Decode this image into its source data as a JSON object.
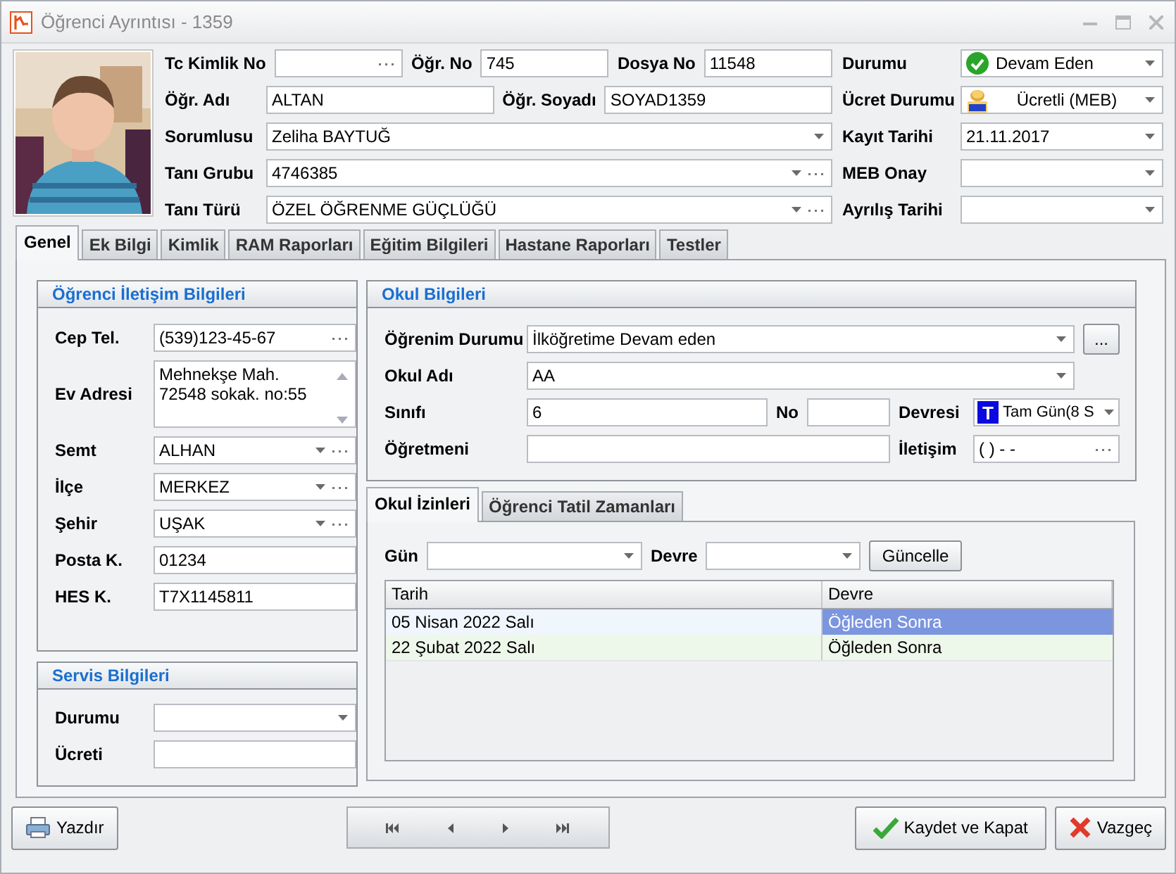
{
  "window": {
    "title": "Öğrenci Ayrıntısı - 1359"
  },
  "header": {
    "left_rows": [
      [
        {
          "label": "Tc Kimlik No",
          "kind": "ellipsis"
        },
        {
          "label": "Öğr. No",
          "value": "745",
          "kind": "text"
        },
        {
          "label": "Dosya No",
          "value": "11548",
          "kind": "text"
        }
      ],
      [
        {
          "label": "Öğr. Adı",
          "value": "ALTAN",
          "kind": "text"
        },
        {
          "label": "Öğr. Soyadı",
          "value": "SOYAD1359",
          "kind": "text"
        }
      ],
      [
        {
          "label": "Sorumlusu",
          "value": "Zeliha BAYTUĞ",
          "kind": "combo"
        }
      ],
      [
        {
          "label": "Tanı Grubu",
          "value": "4746385",
          "kind": "combo_ellipsis"
        }
      ],
      [
        {
          "label": "Tanı Türü",
          "value": "ÖZEL ÖĞRENME GÜÇLÜĞÜ",
          "kind": "combo_ellipsis"
        }
      ]
    ],
    "right_fields": [
      {
        "label": "Durumu",
        "value": "Devam Eden",
        "kind": "check_combo"
      },
      {
        "label": "Ücret Durumu",
        "value": "Ücretli (MEB)",
        "kind": "coin_combo"
      },
      {
        "label": "Kayıt Tarihi",
        "value": "21.11.2017",
        "kind": "combo"
      },
      {
        "label": "MEB Onay",
        "kind": "combo"
      },
      {
        "label": "Ayrılış Tarihi",
        "kind": "combo"
      }
    ]
  },
  "tabs": [
    {
      "label": "Genel",
      "selected": true
    },
    {
      "label": "Ek Bilgi",
      "selected": false
    },
    {
      "label": "Kimlik",
      "selected": false
    },
    {
      "label": "RAM Raporları",
      "selected": false
    },
    {
      "label": "Eğitim Bilgileri",
      "selected": false
    },
    {
      "label": "Hastane Raporları",
      "selected": false
    },
    {
      "label": "Testler",
      "selected": false
    }
  ],
  "contact": {
    "title": "Öğrenci İletişim Bilgileri",
    "fields": [
      {
        "label": "Cep Tel.",
        "value": "(539)123-45-67",
        "kind": "ellipsis"
      },
      {
        "label": "Ev Adresi",
        "value": "Mehnekşe Mah. 72548 sokak. no:55",
        "kind": "memo"
      },
      {
        "label": "Semt",
        "value": "ALHAN",
        "kind": "combo_ellipsis"
      },
      {
        "label": "İlçe",
        "value": "MERKEZ",
        "kind": "combo_ellipsis"
      },
      {
        "label": "Şehir",
        "value": "UŞAK",
        "kind": "combo_ellipsis"
      },
      {
        "label": "Posta K.",
        "value": "01234",
        "kind": "text"
      },
      {
        "label": "HES K.",
        "value": "T7X1145811",
        "kind": "text"
      }
    ]
  },
  "service": {
    "title": "Servis Bilgileri",
    "fields": [
      {
        "label": "Durumu",
        "kind": "combo"
      },
      {
        "label": "Ücreti",
        "kind": "text"
      }
    ]
  },
  "school": {
    "title": "Okul Bilgileri",
    "rows": [
      [
        {
          "kind": "label",
          "text": "Öğrenim Durumu"
        },
        {
          "kind": "combo",
          "value": "İlköğretime Devam eden"
        },
        {
          "kind": "button",
          "text": "..."
        }
      ],
      [
        {
          "kind": "label",
          "text": "Okul Adı"
        },
        {
          "kind": "combo",
          "value": "AA"
        },
        {
          "kind": "spacer"
        }
      ],
      [
        {
          "kind": "label",
          "text": "Sınıfı"
        },
        {
          "kind": "text",
          "value": "6"
        },
        {
          "kind": "label",
          "text": "No"
        },
        {
          "kind": "short_text"
        },
        {
          "kind": "label",
          "text": "Devresi"
        },
        {
          "kind": "shift_combo",
          "badge": "T",
          "value": "Tam Gün(8 S"
        }
      ],
      [
        {
          "kind": "label",
          "text": "Öğretmeni"
        },
        {
          "kind": "text"
        },
        "",
        "",
        {
          "kind": "label",
          "text": "İletişim"
        },
        {
          "kind": "side_ellipsis",
          "value": "(   )   -  -"
        }
      ]
    ]
  },
  "inner_tabs": [
    {
      "label": "Okul İzinleri",
      "selected": true
    },
    {
      "label": "Öğrenci Tatil Zamanları",
      "selected": false
    }
  ],
  "filter": {
    "day_label": "Gün",
    "shift_label": "Devre",
    "button": "Güncelle"
  },
  "table": {
    "columns": [
      "Tarih",
      "Devre"
    ],
    "rows": [
      {
        "cells": [
          "05 Nisan 2022 Salı",
          "Öğleden Sonra"
        ],
        "selected": true
      },
      {
        "cells": [
          "22 Şubat 2022 Salı",
          "Öğleden Sonra"
        ],
        "selected": false
      }
    ]
  },
  "footer": {
    "print": "Yazdır",
    "save": "Kaydet ve Kapat",
    "cancel": "Vazgeç"
  }
}
